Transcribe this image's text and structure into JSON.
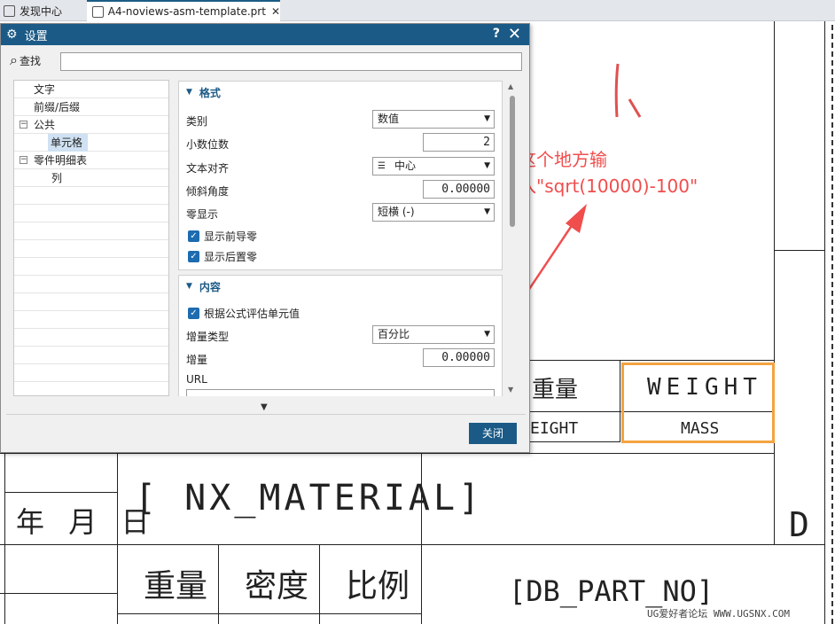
{
  "tabs": [
    {
      "label": "发现中心",
      "active": false
    },
    {
      "label": "A4-noviews-asm-template.prt",
      "active": true,
      "close": "✕"
    }
  ],
  "dialog": {
    "title": "设置",
    "help": "?",
    "close": "✕",
    "search_label": "查找",
    "search_value": "",
    "tree": [
      {
        "label": "文字",
        "level": 1,
        "selected": false
      },
      {
        "label": "前缀/后缀",
        "level": 1,
        "selected": false
      },
      {
        "label": "公共",
        "level": 0,
        "expander": "−",
        "selected": false
      },
      {
        "label": "单元格",
        "level": 2,
        "selected": true
      },
      {
        "label": "零件明细表",
        "level": 0,
        "expander": "−",
        "selected": false
      },
      {
        "label": "列",
        "level": 2,
        "selected": false
      }
    ],
    "format_group": {
      "header": "格式",
      "category_label": "类别",
      "category_value": "数值",
      "decimals_label": "小数位数",
      "decimals_value": "2",
      "align_label": "文本对齐",
      "align_value": "中心",
      "slant_label": "倾斜角度",
      "slant_value": "0.00000",
      "zero_label": "零显示",
      "zero_value": "短横 (-)",
      "leading_zero_label": "显示前导零",
      "trailing_zero_label": "显示后置零"
    },
    "content_group": {
      "header": "内容",
      "formula_label": "根据公式评估单元值",
      "inc_type_label": "增量类型",
      "inc_type_value": "百分比",
      "increment_label": "增量",
      "increment_value": "0.00000",
      "url_label": "URL",
      "url_value": ""
    },
    "close_button": "关闭"
  },
  "annotation": {
    "line1": "这个地方输",
    "line2": "入\"sqrt(10000)-100\""
  },
  "drawing": {
    "weight_cn": "重量",
    "weight_en": "WEIGHT",
    "weight_en_partial": "EIGHT",
    "mass": "MASS",
    "date": "年 月 日",
    "material": "[ NX_MATERIAL]",
    "zhongliang": "重量",
    "midu": "密度",
    "bili": "比例",
    "part_no": "[DB_PART_NO]",
    "d_label": "D"
  },
  "watermark": "UG爱好者论坛 WWW.UGSNX.COM",
  "colors": {
    "title_bar": "#1b5a86",
    "annotation": "#f04d4d",
    "highlight_box": "#f4a341",
    "checkbox": "#1d6bb0"
  }
}
